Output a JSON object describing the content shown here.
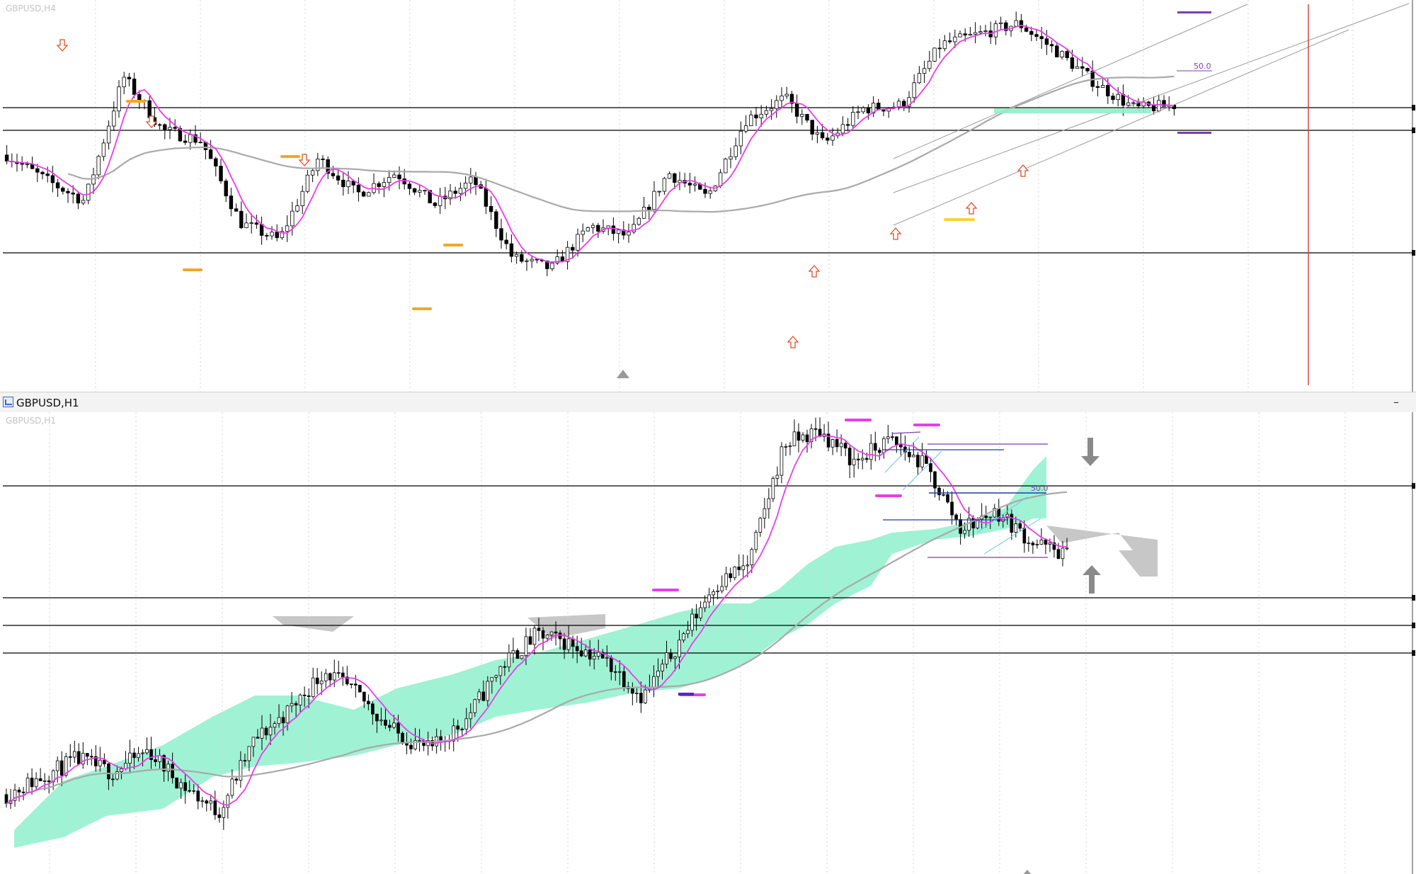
{
  "panes": [
    {
      "id": "h4",
      "watermark": "GBPUSD,H4"
    },
    {
      "id": "h1",
      "title": "GBPUSD,H1",
      "watermark": "GBPUSD,H1",
      "window_button": "–"
    }
  ],
  "annotations": {
    "h4_fibo_label": "50.0",
    "h1_fibo_label": "50.0"
  },
  "colors": {
    "candle": "#000000",
    "fast_ma": "#e83ee8",
    "slow_ma": "#a9a9a9",
    "kumo_bull": "#8ff0cc",
    "kumo_bear": "#c7c7c7",
    "level": "#000000",
    "fractal_arrow": "#e0502a",
    "pivot_marker": "#f5a623",
    "session_line": "#d23b3b"
  },
  "icons": {
    "chart_window": "chart-window-icon",
    "fractal_up": "arrow-up-icon",
    "fractal_down": "arrow-down-icon",
    "projection": "thick-arrow-icon"
  },
  "chart_data": [
    {
      "type": "candlestick",
      "symbol": "GBPUSD",
      "timeframe": "H4",
      "title": "GBPUSD,H4",
      "indicators": [
        "fast moving average (magenta)",
        "slow moving average (gray)",
        "Fractals (arrows)",
        "ascending regression channel",
        "Fibonacci 50.0"
      ],
      "price_path": [
        0.62,
        0.55,
        0.49,
        0.84,
        0.69,
        0.66,
        0.43,
        0.38,
        0.61,
        0.51,
        0.57,
        0.48,
        0.55,
        0.33,
        0.3,
        0.42,
        0.39,
        0.57,
        0.5,
        0.72,
        0.78,
        0.65,
        0.75,
        0.76,
        0.93,
        0.96,
        0.99,
        0.91,
        0.82,
        0.75,
        0.76
      ],
      "horizontal_levels": 3,
      "grid": true
    },
    {
      "type": "candlestick",
      "symbol": "GBPUSD",
      "timeframe": "H1",
      "title": "GBPUSD,H1",
      "indicators": [
        "Ichimoku kumo cloud",
        "fast moving average (magenta)",
        "slow moving average (gray)",
        "Fibonacci 50.0",
        "price channel",
        "projection arrows"
      ],
      "price_path": [
        0.16,
        0.2,
        0.24,
        0.21,
        0.26,
        0.18,
        0.12,
        0.28,
        0.35,
        0.44,
        0.38,
        0.3,
        0.26,
        0.33,
        0.45,
        0.52,
        0.5,
        0.46,
        0.38,
        0.5,
        0.63,
        0.68,
        0.95,
        0.98,
        0.91,
        0.96,
        0.9,
        0.76,
        0.8,
        0.73,
        0.7
      ],
      "horizontal_levels": 4,
      "grid": true
    }
  ]
}
